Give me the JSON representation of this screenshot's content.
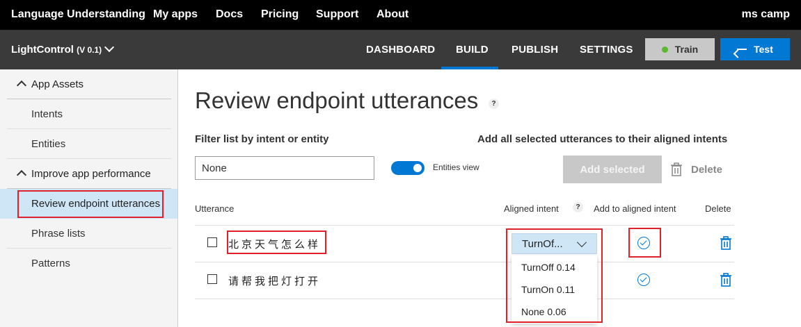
{
  "topnav": {
    "brand": "Language Understanding",
    "links": [
      "My apps",
      "Docs",
      "Pricing",
      "Support",
      "About"
    ],
    "user": "ms camp"
  },
  "appbar": {
    "app_name": "LightControl",
    "version": "(V 0.1)",
    "tabs": [
      "DASHBOARD",
      "BUILD",
      "PUBLISH",
      "SETTINGS"
    ],
    "active_tab": "BUILD",
    "train_label": "Train",
    "test_label": "Test"
  },
  "sidebar": {
    "sections": [
      {
        "label": "App Assets",
        "items": [
          "Intents",
          "Entities"
        ]
      },
      {
        "label": "Improve app performance",
        "items": [
          "Review endpoint utterances",
          "Phrase lists",
          "Patterns"
        ]
      }
    ],
    "active_item": "Review endpoint utterances"
  },
  "main": {
    "title": "Review endpoint utterances",
    "help_mark": "?",
    "filter_label": "Filter list by intent or entity",
    "filter_value": "None",
    "entities_view_label": "Entities view",
    "entities_view_on": true,
    "add_all_label": "Add all selected utterances to their aligned intents",
    "add_selected_label": "Add selected",
    "delete_label": "Delete",
    "columns": {
      "utterance": "Utterance",
      "aligned_intent": "Aligned intent",
      "add_to_aligned": "Add to aligned intent",
      "delete": "Delete"
    },
    "rows": [
      {
        "utterance": "北京天气怎么样",
        "aligned_intent": "TurnOf..."
      },
      {
        "utterance": "请帮我把灯打开"
      }
    ],
    "dropdown_options": [
      "TurnOff 0.14",
      "TurnOn 0.11",
      "None 0.06"
    ]
  },
  "colors": {
    "accent": "#0078d4",
    "highlight": "#e0202a",
    "train_dot": "#5cb82c"
  }
}
